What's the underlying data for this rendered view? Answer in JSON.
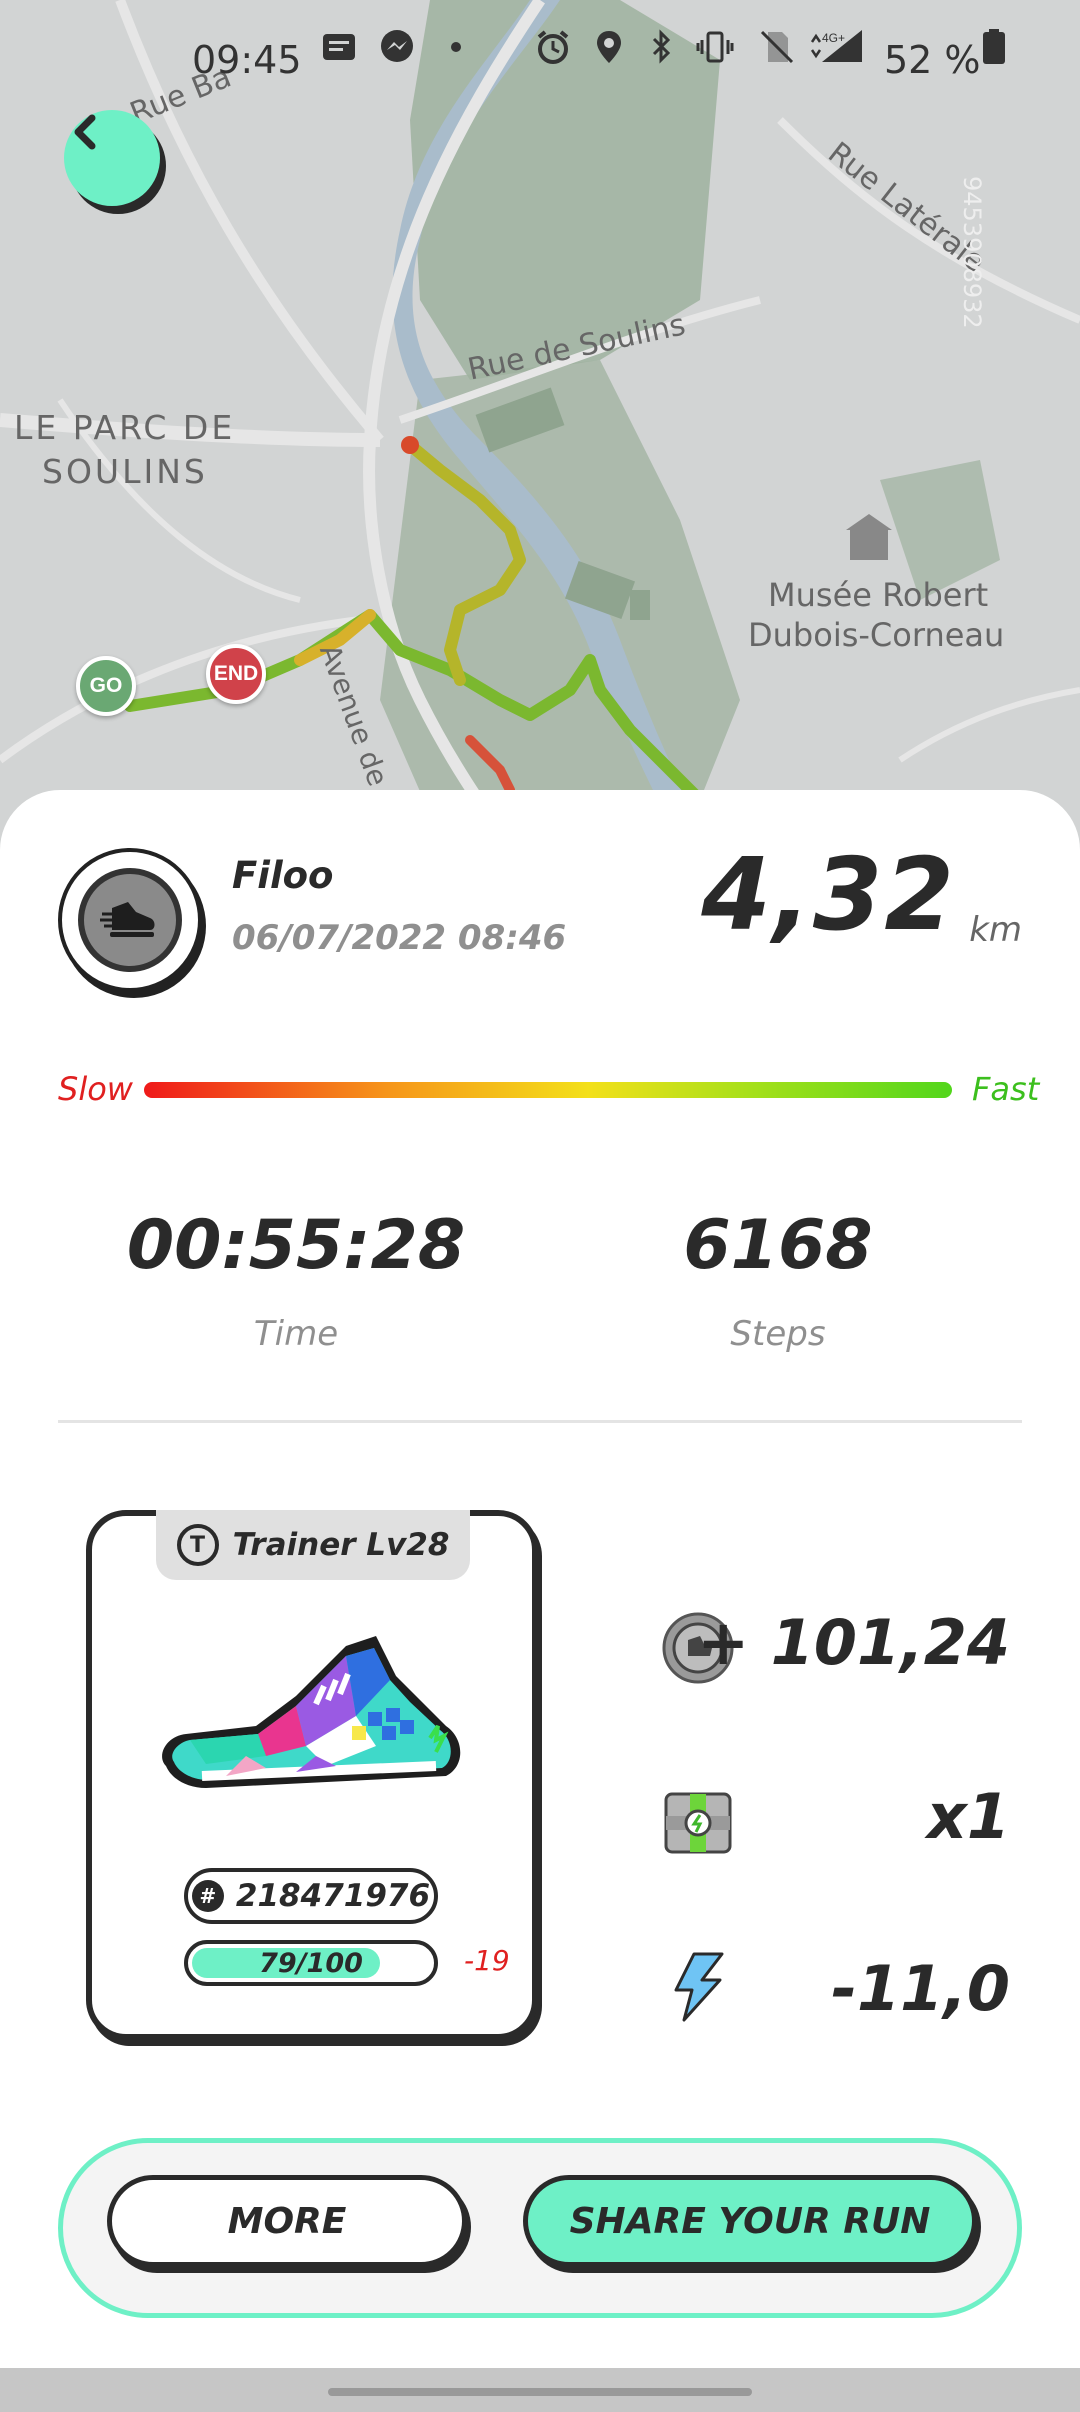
{
  "status_bar": {
    "time": "09:45",
    "battery_percent": "52 %",
    "icons": [
      "message-icon",
      "messenger-icon",
      "dot-icon",
      "alarm-icon",
      "location-icon",
      "bluetooth-icon",
      "vibrate-icon",
      "no-sim-icon",
      "signal-4g-icon",
      "battery-icon"
    ]
  },
  "map": {
    "labels": {
      "rue_ba": "Rue Ba",
      "rue_laterale": "Rue Latérale",
      "rue_de_soulins": "Rue de Soulins",
      "parc_line1": "LE PARC DE",
      "parc_line2": "SOULINS",
      "musee_line1": "Musée Robert",
      "musee_line2": "Dubois-Corneau",
      "avenue": "Avenue de Pierre D",
      "map_id": "9453908932"
    },
    "markers": {
      "start": "GO",
      "end": "END"
    }
  },
  "run": {
    "user_name": "Filoo",
    "date": "06/07/2022 08:46",
    "distance": "4,32",
    "distance_unit": "km",
    "speed_scale": {
      "slow_label": "Slow",
      "fast_label": "Fast"
    },
    "time": "00:55:28",
    "time_label": "Time",
    "steps": "6168",
    "steps_label": "Steps"
  },
  "trainer": {
    "badge_letter": "T",
    "level_label": "Trainer Lv28",
    "id_symbol": "#",
    "shoe_id": "218471976",
    "durability_text": "79/100",
    "durability_fraction": 0.79,
    "durability_delta": "-19"
  },
  "rewards": {
    "gst": "+ 101,24",
    "mystery_box": "x1",
    "energy": "-11,0"
  },
  "actions": {
    "more_label": "MORE",
    "share_label": "SHARE YOUR RUN"
  },
  "colors": {
    "accent": "#6ef0c6",
    "dark": "#2a2a2a",
    "slow": "#e02020",
    "fast": "#3cbf1d"
  }
}
